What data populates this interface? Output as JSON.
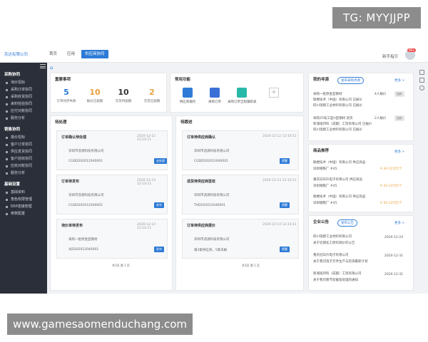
{
  "watermark_top": "TG: MYYJJPP",
  "watermark_bottom": "www.gamesaomenduchang.com",
  "header": {
    "company": "苏达有限公司",
    "nav": [
      "首页",
      "应用",
      "供应商协同"
    ],
    "user": "新手指引",
    "badge": "99+"
  },
  "sidebar": {
    "sections": [
      {
        "title": "采购协同",
        "items": [
          "询价招标",
          "采购订单协同",
          "采购收货协同",
          "来料检验协同",
          "应付对账协同",
          "服务分析"
        ]
      },
      {
        "title": "销售协同",
        "items": [
          "报价招标",
          "客户订单协同",
          "供应发货协同",
          "客户验收协同",
          "应收对账协同",
          "服务分析"
        ]
      },
      {
        "title": "基础设置",
        "items": [
          "基础资料",
          "角色权限管理",
          "ERP连接管理",
          "参数配置"
        ]
      }
    ]
  },
  "todo": {
    "title": "重要事项",
    "stats": [
      {
        "num": "5",
        "label": "订单同步失败",
        "color": "#2e7bd6"
      },
      {
        "num": "10",
        "label": "报价已逾期",
        "color": "#e6a23c"
      },
      {
        "num": "10",
        "label": "交货待逾期",
        "color": "#333333"
      },
      {
        "num": "2",
        "label": "交货已逾期",
        "color": "#e6a23c"
      }
    ]
  },
  "functions": {
    "title": "常用功能",
    "items": [
      {
        "label": "供应商邀约",
        "color": "#2e7bd6"
      },
      {
        "label": "采购订单",
        "color": "#3a6fd8"
      },
      {
        "label": "采购订单全程跟踪表",
        "color": "#28b8a8"
      }
    ]
  },
  "pending": {
    "title": "待处理",
    "cards": [
      {
        "title": "订单确认待处理",
        "date": "2020-12-12 12:10:11",
        "company": "深圳市浩源科技有限公司",
        "code": "CGDD202012040001",
        "btn": "去处理"
      },
      {
        "title": "订单待发布",
        "date": "2020-12-13 12:10:11",
        "company": "深圳市浩源科技有限公司",
        "code": "CGDD202012040001",
        "btn": "发布"
      },
      {
        "title": "询价单待发布",
        "date": "2020-12-14 12:10:11",
        "company": "采购一批原金型钢材",
        "code": "XJD202012040001",
        "btn": "发布"
      }
    ],
    "pager": "共3页  第  1  页"
  },
  "tracking": {
    "title": "待跟进",
    "cards": [
      {
        "title": "订单待供应商确认",
        "date": "2020-12-12 12:10:11",
        "company": "深圳市浩源科技有限公司",
        "code": "CGDD202012040001",
        "btn": "提醒"
      },
      {
        "title": "退货待供应商签收",
        "date": "2020-12-13 12:10:11",
        "company": "深圳市浩源科技有限公司",
        "code": "THD202012040001",
        "btn": "提醒"
      },
      {
        "title": "订单待供应商报价",
        "date": "2020-12-14 12:10:11",
        "company": "深圳市浩源科技有限公司",
        "code": "邀3家供应商，5家未报",
        "btn": "提醒"
      }
    ],
    "pager": "共3页  第  1  页"
  },
  "inquiry": {
    "title": "我的寻源",
    "btn": "发布采购寻源",
    "more": "更多 >",
    "items": [
      {
        "l1": "采购一批原金型钢材",
        "l2": "联楼技术（中国）有限公司  已报价",
        "l3": "四川瑞建工业材料有限公司  已报价",
        "count": "4人报价",
        "b": "比价"
      },
      {
        "l1": "采购25吨工型H型钢材 退货",
        "l2": "新城纽邦科（成都）工贸有限公司  已报价",
        "l3": "四川瑞建工业材料有限公司  已报价",
        "count": "2人报价",
        "b": "比价"
      }
    ]
  },
  "recommend": {
    "title": "商品推荐",
    "more": "更多 >",
    "items": [
      {
        "l1": "联楼技术（中国）有限公司 供应商品",
        "l2": "深圳钢铁厂 #45",
        "price": "¥ 30-125元/个"
      },
      {
        "l1": "重庆冠日升电子有限公司 供应商品",
        "l2": "深圳钢铁厂 #45",
        "price": "¥ 30-125元/个"
      },
      {
        "l1": "联楼技术（中国）有限公司 供应商品",
        "l2": "深圳钢铁厂 #45",
        "price": "¥ 30-125元/个"
      }
    ]
  },
  "notice": {
    "title": "企业公告",
    "btn": "发布公告",
    "more": "更多 >",
    "items": [
      {
        "l1": "四川瑞建工业材料有限公司",
        "l2": "关于近期化工原料调价的公告",
        "date": "2020-12-24"
      },
      {
        "l1": "重庆冠日升电子有限公司",
        "l2": "关于我司电子元件生产与检测最新计划",
        "date": "2020-12-31"
      },
      {
        "l1": "新城纽邦科（成都）工贸有限公司",
        "l2": "关于我司春节前截留处理的通知",
        "date": "2020-12-31"
      }
    ]
  }
}
